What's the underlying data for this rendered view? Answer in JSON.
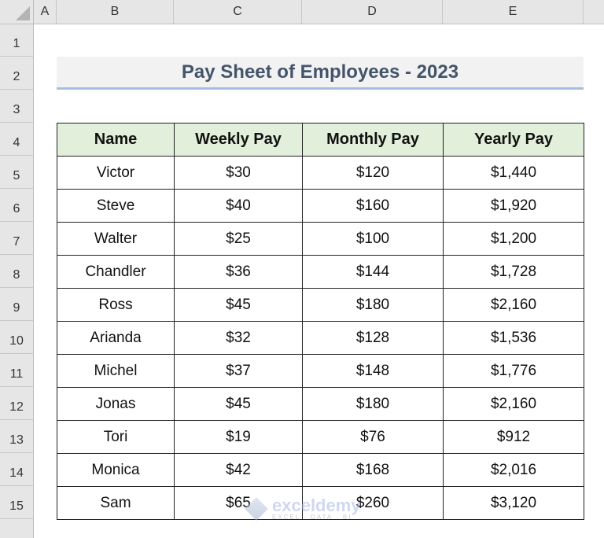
{
  "sheet": {
    "columns": [
      "A",
      "B",
      "C",
      "D",
      "E"
    ],
    "rows": [
      "1",
      "2",
      "3",
      "4",
      "5",
      "6",
      "7",
      "8",
      "9",
      "10",
      "11",
      "12",
      "13",
      "14",
      "15"
    ]
  },
  "title": "Pay Sheet of Employees - 2023",
  "table": {
    "headers": [
      "Name",
      "Weekly Pay",
      "Monthly Pay",
      "Yearly Pay"
    ],
    "rows": [
      [
        "Victor",
        "$30",
        "$120",
        "$1,440"
      ],
      [
        "Steve",
        "$40",
        "$160",
        "$1,920"
      ],
      [
        "Walter",
        "$25",
        "$100",
        "$1,200"
      ],
      [
        "Chandler",
        "$36",
        "$144",
        "$1,728"
      ],
      [
        "Ross",
        "$45",
        "$180",
        "$2,160"
      ],
      [
        "Arianda",
        "$32",
        "$128",
        "$1,536"
      ],
      [
        "Michel",
        "$37",
        "$148",
        "$1,776"
      ],
      [
        "Jonas",
        "$45",
        "$180",
        "$2,160"
      ],
      [
        "Tori",
        "$19",
        "$76",
        "$912"
      ],
      [
        "Monica",
        "$42",
        "$168",
        "$2,016"
      ],
      [
        "Sam",
        "$65",
        "$260",
        "$3,120"
      ]
    ]
  },
  "watermark": {
    "main": "exceldemy",
    "sub": "EXCEL · DATA · BI"
  },
  "colors": {
    "header_fill": "#e2efda",
    "title_fill": "#f2f2f2",
    "title_text": "#44546a",
    "title_underline": "#a8bce0"
  }
}
